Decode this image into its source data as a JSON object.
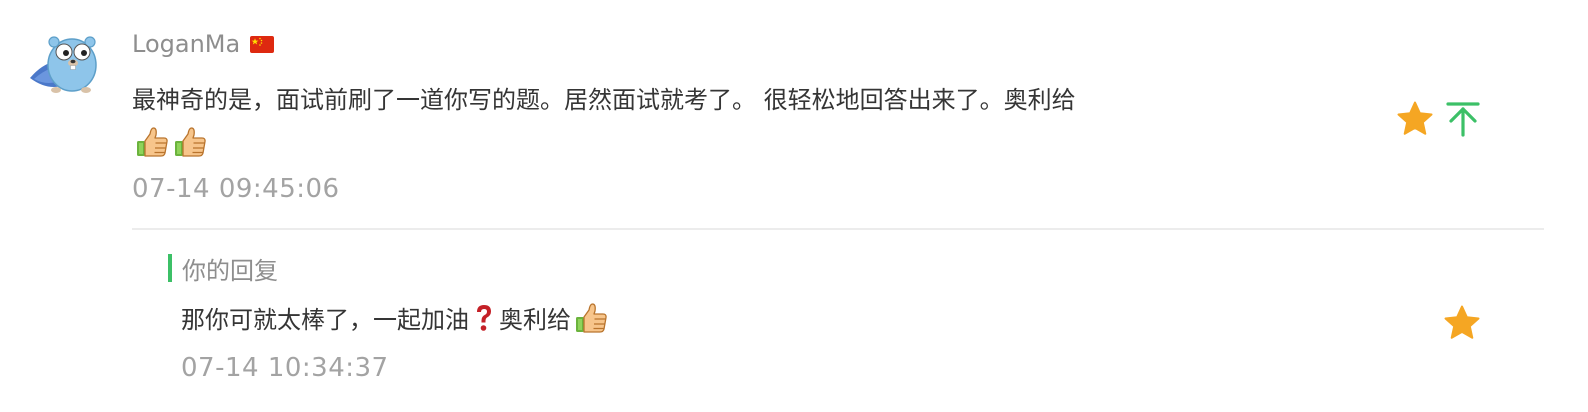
{
  "comment": {
    "author": "LoganMa",
    "avatar_icon": "gopher-avatar-icon",
    "flag_icon": "china-flag-icon",
    "text": "最神奇的是，面试前刷了一道你写的题。居然面试就考了。 很轻松地回答出来了。奥利给",
    "emoji_icons": [
      "thumbs-up-icon",
      "thumbs-up-icon"
    ],
    "timestamp": "07-14 09:45:06",
    "actions": {
      "star_icon": "star-icon",
      "pin_top_icon": "pin-top-icon"
    }
  },
  "reply": {
    "label": "你的回复",
    "text_before": "那你可就太棒了，一起加油",
    "question_icon": "question-mark-icon",
    "text_after": "奥利给",
    "emoji_icons": [
      "thumbs-up-icon"
    ],
    "timestamp": "07-14 10:34:37",
    "actions": {
      "star_icon": "star-icon"
    }
  },
  "colors": {
    "author": "#8e8e8e",
    "text": "#353535",
    "timestamp": "#a3a3a3",
    "star": "#f5a623",
    "pin_top": "#3cc067",
    "reply_bar": "#3cc067",
    "divider": "#ececec"
  }
}
